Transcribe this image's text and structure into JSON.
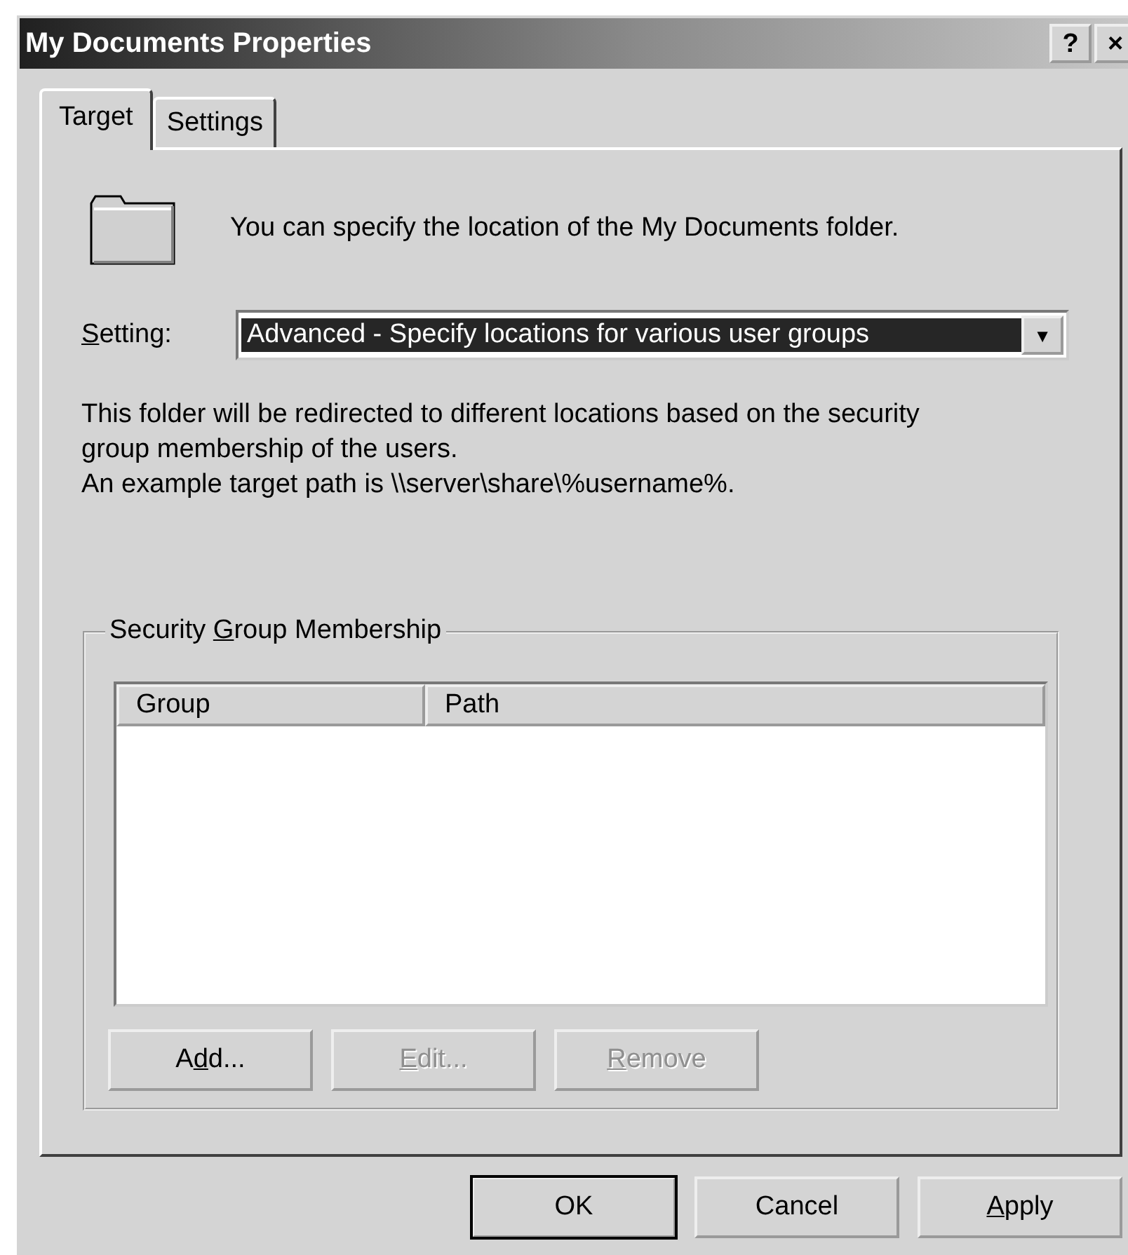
{
  "window": {
    "title": "My Documents Properties",
    "title_buttons": [
      "?",
      "×"
    ]
  },
  "tabs": [
    {
      "label": "Target",
      "selected": true
    },
    {
      "label": "Settings",
      "selected": false
    }
  ],
  "intro": "You can specify the location of the My Documents folder.",
  "setting": {
    "label": {
      "key": "S",
      "post": "etting:"
    },
    "value": "Advanced - Specify locations for various user groups",
    "focused": true,
    "arrow": "▼"
  },
  "description": [
    "This folder will be redirected to different locations based on the security group membership of the users.",
    "An example target path is \\\\server\\share\\%username%."
  ],
  "group": {
    "label": {
      "pre": "Security ",
      "key": "G",
      "post": "roup Membership"
    },
    "columns": [
      "Group",
      "Path"
    ],
    "buttons": [
      {
        "pre": "A",
        "key": "d",
        "post": "d...",
        "disabled": false
      },
      {
        "key": "E",
        "post": "dit...",
        "disabled": true
      },
      {
        "key": "R",
        "post": "emove",
        "disabled": true
      }
    ]
  },
  "buttons": [
    {
      "pre": "OK",
      "default": true
    },
    {
      "pre": "Cancel",
      "default": false
    },
    {
      "key": "A",
      "post": "pply",
      "default": false
    }
  ]
}
